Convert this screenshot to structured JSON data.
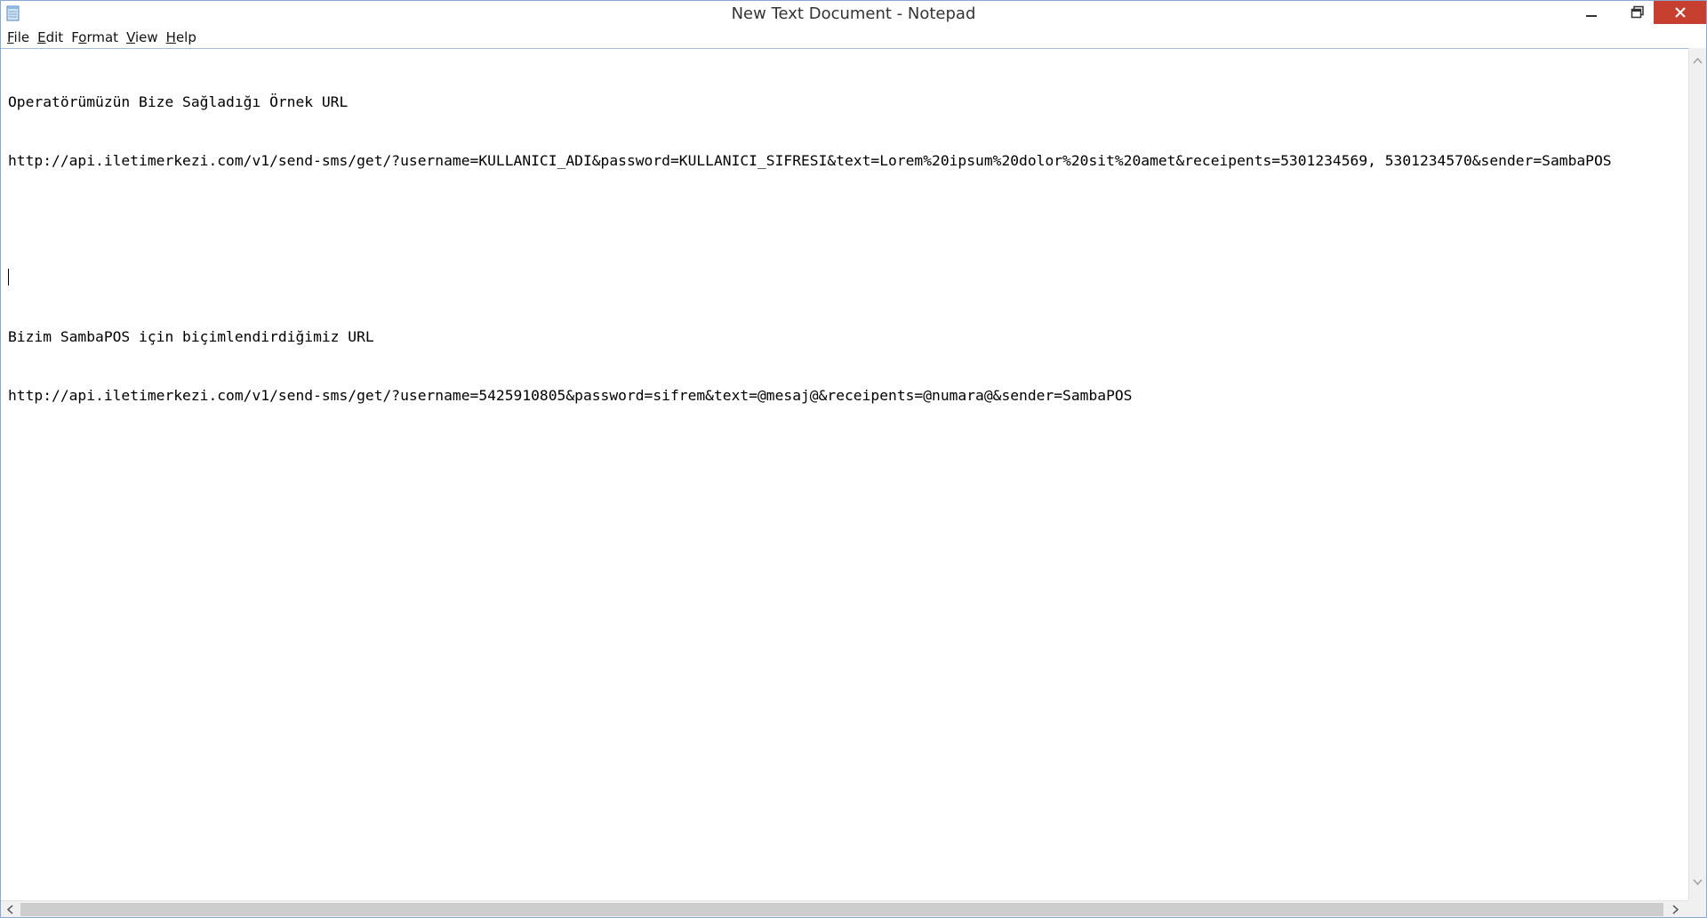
{
  "window": {
    "title": "New Text Document - Notepad"
  },
  "menu": {
    "items": [
      {
        "mnemonic": "F",
        "rest": "ile"
      },
      {
        "mnemonic": "E",
        "rest": "dit"
      },
      {
        "mnemonic": "o",
        "rest": "rmat",
        "prefix": "F"
      },
      {
        "mnemonic": "V",
        "rest": "iew"
      },
      {
        "mnemonic": "H",
        "rest": "elp"
      }
    ]
  },
  "document": {
    "lines": [
      "Operatörümüzün Bize Sağladığı Örnek URL",
      "http://api.iletimerkezi.com/v1/send-sms/get/?username=KULLANICI_ADI&password=KULLANICI_SIFRESI&text=Lorem%20ipsum%20dolor%20sit%20amet&receipents=5301234569, 5301234570&sender=SambaPOS",
      "",
      "",
      "Bizim SambaPOS için biçimlendirdiğimiz URL",
      "http://api.iletimerkezi.com/v1/send-sms/get/?username=5425910805&password=sifrem&text=@mesaj@&receipents=@numara@&sender=SambaPOS"
    ]
  },
  "icons": {
    "app": "notepad-icon",
    "minimize": "minimize-icon",
    "maximize": "maximize-icon",
    "close": "close-icon"
  },
  "colors": {
    "close_button": "#c7402f",
    "window_border": "#8aa8d0"
  }
}
